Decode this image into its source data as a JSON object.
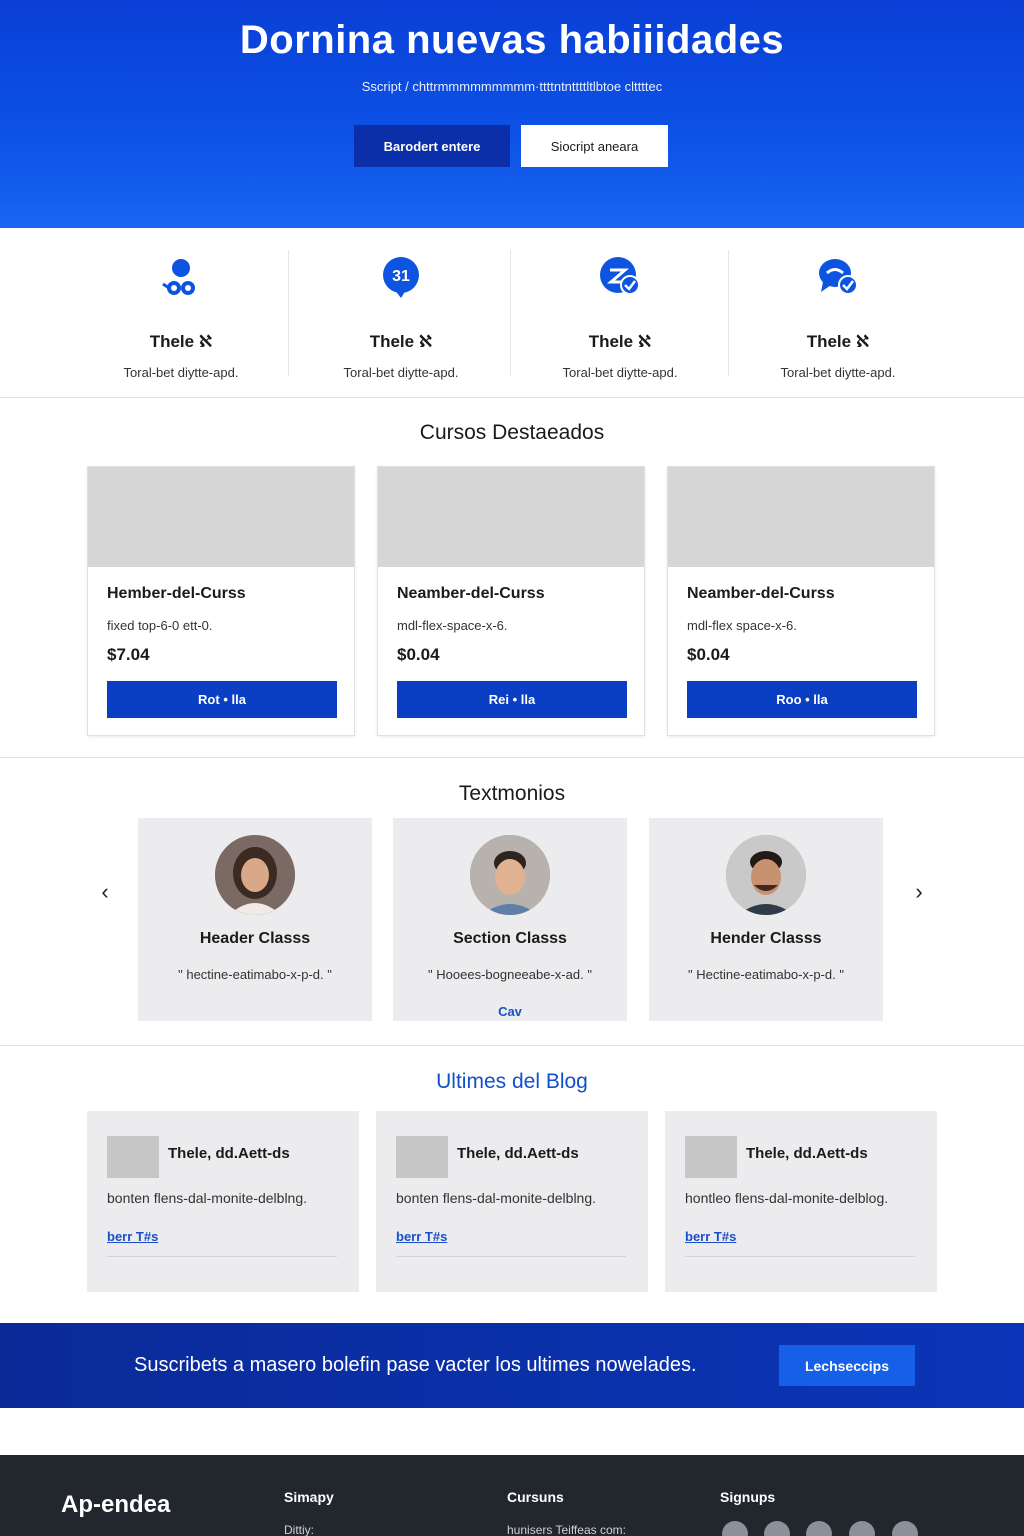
{
  "hero": {
    "title": "Dornina nuevas habiiidades",
    "subtitle": "Sscript / chttrmmmmmmmmm·ttttntnttttltlbtoe clttttec",
    "primary_button": "Barodert entere",
    "secondary_button": "Siocript aneara"
  },
  "features": [
    {
      "icon": "users-icon",
      "title": "Thele ℵ",
      "desc": "Toral-bet diytte-apd."
    },
    {
      "icon": "calendar-badge-icon",
      "badge": "31",
      "title": "Thele ℵ",
      "desc": "Toral-bet diytte-apd."
    },
    {
      "icon": "chat-check-icon",
      "title": "Thele ℵ",
      "desc": "Toral-bet diytte-apd."
    },
    {
      "icon": "messages-icon",
      "title": "Thele ℵ",
      "desc": "Toral-bet diytte-apd."
    }
  ],
  "courses_section": {
    "title": "Cursos Destaeados",
    "items": [
      {
        "title": "Hember-del-Curss",
        "desc": "fixed top-6-0 ett-0.",
        "price": "$7.04",
        "button": "Rot • lla"
      },
      {
        "title": "Neamber-del-Curss",
        "desc": "mdl-flex-space-x-6.",
        "price": "$0.04",
        "button": "Rei • lla"
      },
      {
        "title": "Neamber-del-Curss",
        "desc": "mdl-flex space-x-6.",
        "price": "$0.04",
        "button": "Roo • lla"
      }
    ]
  },
  "testimonials_section": {
    "title": "Textmonios",
    "items": [
      {
        "name": "Header Classs",
        "quote": "\" hectine-eatimabo-x-p-d. \"",
        "more": ""
      },
      {
        "name": "Section Classs",
        "quote": "\" Hooees-bogneeabe-x-ad. \"",
        "more": "Cav"
      },
      {
        "name": "Hender Classs",
        "quote": "\" Hectine-eatimabo-x-p-d. \"",
        "more": ""
      }
    ]
  },
  "blog_section": {
    "title": "Ultimes del Blog",
    "items": [
      {
        "title": "Thele, dd.Aett-ds",
        "desc": "bonten flens-dal-monite-delblng.",
        "link": "berr T#s"
      },
      {
        "title": "Thele, dd.Aett-ds",
        "desc": "bonten flens-dal-monite-delblng.",
        "link": "berr T#s"
      },
      {
        "title": "Thele, dd.Aett-ds",
        "desc": "hontleo flens-dal-monite-delblog.",
        "link": "berr T#s"
      }
    ]
  },
  "newsletter": {
    "text": "Suscribets a masero bolefin pase vacter los ultimes nowelades.",
    "button": "Lechseccips"
  },
  "footer": {
    "brand": "Ap-endea",
    "columns": [
      {
        "heading": "Simapy",
        "item": "Dittiy:"
      },
      {
        "heading": "Cursuns",
        "item": "hunisers Teiffeas com:"
      },
      {
        "heading": "Signups",
        "item": ""
      }
    ],
    "social": [
      "plus-icon",
      "person-icon",
      "mail-icon",
      "phone-icon",
      "m-icon"
    ]
  },
  "colors": {
    "brand_blue": "#0d52e6",
    "button_blue": "#0a3fc4",
    "newsletter_bg": "#0a2a98",
    "footer_bg": "#22262d"
  }
}
